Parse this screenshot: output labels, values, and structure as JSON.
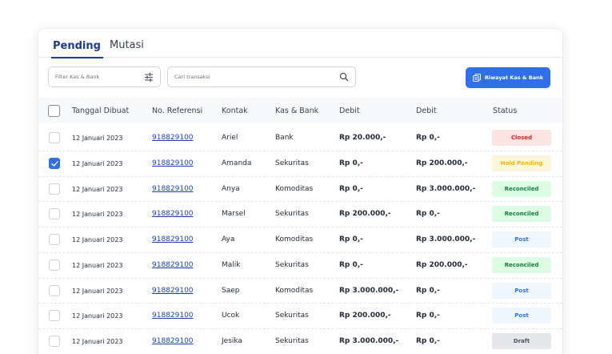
{
  "tabs": [
    {
      "label": "Pending",
      "active": true
    },
    {
      "label": "Mutasi",
      "active": false
    }
  ],
  "toolbar": {
    "filter_placeholder": "Filter Kas & Bank",
    "search_placeholder": "Cari transaksi",
    "riwayat_label": "Riwayat Kas & Bank"
  },
  "colors": {
    "accent": "#2f6fea",
    "tab_active": "#1e3a8a",
    "link": "#1e40af"
  },
  "table": {
    "columns": [
      "Tanggal Dibuat",
      "No. Referensi",
      "Kontak",
      "Kas & Bank",
      "Debit",
      "Debit",
      "Status"
    ],
    "rows": [
      {
        "date": "12 Januari 2023",
        "ref": "918829100",
        "contact": "Ariel",
        "account": "Bank",
        "debit1": "Rp 20.000,-",
        "debit2": "Rp 0,-",
        "status": "Closed",
        "checked": false
      },
      {
        "date": "12 Januari 2023",
        "ref": "918829100",
        "contact": "Amanda",
        "account": "Sekuritas",
        "debit1": "Rp 0,-",
        "debit2": "Rp 200.000,-",
        "status": "Hold Pending",
        "checked": true
      },
      {
        "date": "12 Januari 2023",
        "ref": "918829100",
        "contact": "Anya",
        "account": "Komoditas",
        "debit1": "Rp 0,-",
        "debit2": "Rp 3.000.000,-",
        "status": "Reconciled",
        "checked": false
      },
      {
        "date": "12 Januari 2023",
        "ref": "918829100",
        "contact": "Marsel",
        "account": "Sekuritas",
        "debit1": "Rp 200.000,-",
        "debit2": "Rp 0,-",
        "status": "Reconciled",
        "checked": false
      },
      {
        "date": "12 Januari 2023",
        "ref": "918829100",
        "contact": "Aya",
        "account": "Komoditas",
        "debit1": "Rp 0,-",
        "debit2": "Rp 3.000.000,-",
        "status": "Post",
        "checked": false
      },
      {
        "date": "12 Januari 2023",
        "ref": "918829100",
        "contact": "Malik",
        "account": "Sekuritas",
        "debit1": "Rp 0,-",
        "debit2": "Rp 200.000,-",
        "status": "Reconciled",
        "checked": false
      },
      {
        "date": "12 Januari 2023",
        "ref": "918829100",
        "contact": "Saep",
        "account": "Komoditas",
        "debit1": "Rp 3.000.000,-",
        "debit2": "Rp 0,-",
        "status": "Post",
        "checked": false
      },
      {
        "date": "12 Januari 2023",
        "ref": "918829100",
        "contact": "Ucok",
        "account": "Sekuritas",
        "debit1": "Rp 200.000,-",
        "debit2": "Rp 0,-",
        "status": "Post",
        "checked": false
      },
      {
        "date": "12 Januari 2023",
        "ref": "918829100",
        "contact": "Jesika",
        "account": "Sekuritas",
        "debit1": "Rp 3.000.000,-",
        "debit2": "Rp 0,-",
        "status": "Draft",
        "checked": false
      }
    ]
  },
  "status_styles": {
    "Closed": {
      "bg": "#fde2e2",
      "fg": "#dc2626"
    },
    "Hold Pending": {
      "bg": "#fef6d8",
      "fg": "#f5b50a"
    },
    "Reconciled": {
      "bg": "#dcfce4",
      "fg": "#15803d"
    },
    "Post": {
      "bg": "#eef6ff",
      "fg": "#2f6fea"
    },
    "Draft": {
      "bg": "#e5e7eb",
      "fg": "#4b5563"
    }
  }
}
